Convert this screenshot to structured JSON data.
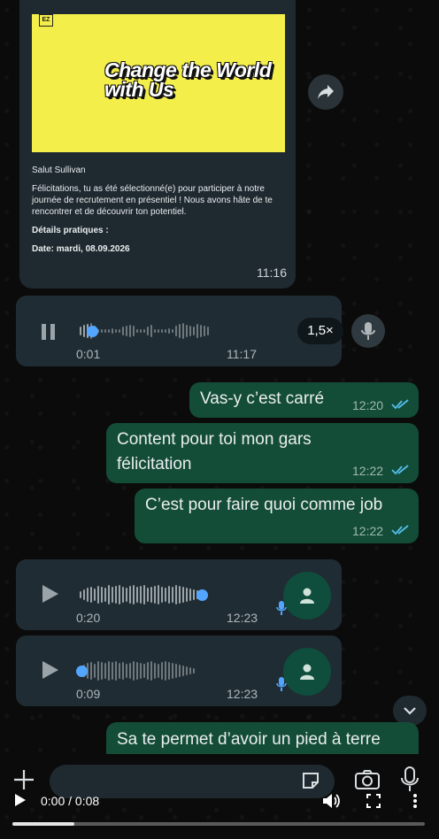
{
  "email_card": {
    "banner_text": "Change the World with Us",
    "logo_text": "EZ",
    "greeting": "Salut Sullivan",
    "body": "Félicitations, tu as été sélectionné(e) pour participer à notre journée de recrutement en présentiel ! Nous avons hâte de te rencontrer et de découvrir ton potentiel.",
    "details_heading": "Détails pratiques :",
    "date_line": "Date: mardi, 08.09.2026",
    "time": "11:16"
  },
  "voice_note_1": {
    "elapsed": "0:01",
    "time": "11:17",
    "speed": "1,5×",
    "progress": 0.08
  },
  "messages": [
    {
      "text": "Vas-y c’est carré",
      "time": "12:20"
    },
    {
      "text_line1": "Content pour toi mon gars",
      "text_line2": "félicitation",
      "time": "12:22"
    },
    {
      "text": "C’est pour faire quoi comme job",
      "time": "12:22"
    }
  ],
  "voice_note_2": {
    "duration": "0:20",
    "time": "12:23",
    "progress": 1.0
  },
  "voice_note_3": {
    "duration": "0:09",
    "time": "12:23",
    "progress": 0.0
  },
  "last_message": {
    "text": "Sa te permet d’avoir un pied à terre"
  },
  "video": {
    "time_display": "0:00 / 0:08",
    "progress": 0.15
  },
  "colors": {
    "accent_tick": "#53bdeb",
    "outgoing_bubble": "#144d37",
    "incoming_bubble": "#202c33",
    "banner_yellow": "#f3ee4a"
  }
}
